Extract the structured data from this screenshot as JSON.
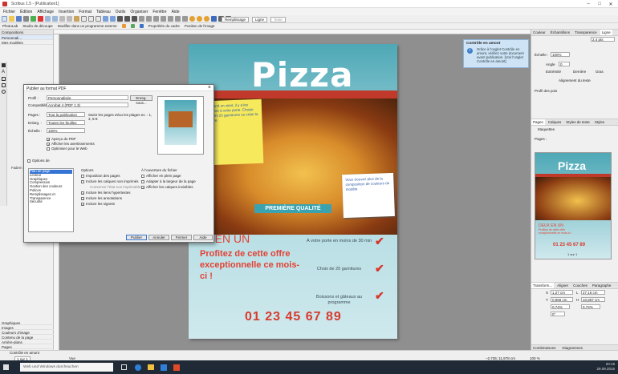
{
  "window": {
    "title": "Scribus 1.5 - [Publication1]",
    "minimize": "–",
    "maximize": "□",
    "close": "✕"
  },
  "menu": [
    "Fichier",
    "Édition",
    "Affichage",
    "Insertion",
    "Format",
    "Tableau",
    "Outils",
    "Organiser",
    "Fenêtre",
    "Aide"
  ],
  "toolbar2": [
    "PhotoLab",
    "Studio de découpe",
    "Modifier dans un programme externe",
    "Propriétés du cadre",
    "Position de l'image"
  ],
  "toolbar_right": {
    "fill": "Remplissage",
    "line": "Ligne",
    "text": "Texte"
  },
  "left_panel": {
    "head": "Compositions",
    "items": [
      "Personnali...",
      "Mes modèles"
    ],
    "bottom_items": [
      "Graphiques",
      "Images",
      "Couleurs d'image",
      "Contenu de la page",
      "Arrière-plans",
      "Pages",
      "Rechercher"
    ],
    "side_items": [
      "Fadern"
    ],
    "contrôle": "Contrôle en amont"
  },
  "dialog": {
    "title": "Publier au format PDF",
    "labels": {
      "profil": "Profil :",
      "compat": "Compatibilité :",
      "pages": "Pages :",
      "enlarg": "Enlarg. :",
      "echelle": "Échelle :",
      "options_de": "Options de",
      "options": "Options",
      "ouverture": "À l'ouverture du fichier"
    },
    "values": {
      "profil": "Personnalisée",
      "compat": "Acrobat 4 (PDF 1.3)",
      "pages": "Tout la publication",
      "enlarg": "Toutes les feuilles",
      "echelle": "100%"
    },
    "pages_hint": "Saisir les pages et/ou les plages ex. : 1, 3, 5-8",
    "buttons": {
      "enreg": "Enreg. sous...",
      "publier": "Publier",
      "annuler": "Annuler",
      "fermer": "Fermer",
      "aide": "Aide"
    },
    "checks_top": [
      "Aperçu du PDF",
      "Afficher les avertissements",
      "Optimiser pour le Web"
    ],
    "list": [
      "Plan de page",
      "Lecteur",
      "Graphiques",
      "Compression",
      "Gestion des couleurs",
      "Polices",
      "Remplissages et Transparence",
      "Sécurité"
    ],
    "options_checks": [
      "Imposition des pages",
      "Inclure les calques non imprimés",
      "Inclure les liens hypertextes",
      "Inclure les annotations",
      "Inclure les signets"
    ],
    "options_note": "Conserver l'état non imprimable",
    "open_checks": [
      "Afficher en plein page",
      "Adapter à la largeur de la page",
      "Afficher les calques invisibles"
    ]
  },
  "poster": {
    "title": "Pizza",
    "sticky1": "Quand on vient, il y a les pizzas à votre porte. Choisir parmi 20 garnitures ou créer la vôtre.",
    "sticky2": "Vous trouvez plus de la composition de couleurs du modèle",
    "quality": "PREMIÈRE QUALITÉ",
    "offer_head": "EUX EN UN",
    "offer_body": "Profitez de cette offre exceptionnelle ce mois-ci !",
    "features": [
      "À votre porte en moins de 30 min",
      "Choix de 20 garnitures",
      "Boissons et gâteaux au programme"
    ],
    "phone": "01 23 45 67 89"
  },
  "right_dock": {
    "tabs": [
      "Couleur",
      "Échantillons",
      "Transparence",
      "Ligne"
    ],
    "fields": {
      "width": "2,4 pts",
      "scale": "100%",
      "angle": "0"
    },
    "labels": {
      "echelle": "Échelle :",
      "angle": "Angle",
      "extremite": "Extrémité",
      "derriere": "Derrière",
      "gras": "Gras",
      "alignement": "Alignement du texte",
      "profil": "Profil des pois"
    },
    "pages_tabs": [
      "Pages",
      "Calques",
      "Styles de texte",
      "Styles"
    ],
    "pages_head": "Maquettes",
    "pages_label": "Pages :",
    "thumb_text": {
      "title": "Pizza",
      "offer": "DEUX EN UN",
      "sub": "Profitez de cette offre exceptionnelle ce mois-ci !",
      "phone": "01 23 45 67 89",
      "footer": "1 sur 1"
    },
    "tooltip_head": "Contrôle en amont",
    "tooltip_body": "Grâce à l'onglet Contrôle en amont, vérifiez votre document avant publication. [Voir l'onglet Contrôle en amont]",
    "props_tabs": [
      "Transform...",
      "Aligner",
      "Couches",
      "Paragraphe"
    ],
    "coords": {
      "x": "1,27 cm",
      "y": "0,966 cm",
      "w": "27,16 cm",
      "h": "10,867 cm",
      "scale1": "0,74%",
      "scale2": "0,74%",
      "rot": "0°"
    },
    "bottom_tabs": [
      "Combinaisons",
      "Diagrammes"
    ]
  },
  "status": {
    "page": "1 sur 1",
    "view": "Vue",
    "coords": "–2,735; 11,978 cm",
    "zoom": "100 %"
  },
  "taskbar": {
    "search": "Web und Windows durchsuchen",
    "time": "20:19",
    "date": "29.09.2016"
  }
}
